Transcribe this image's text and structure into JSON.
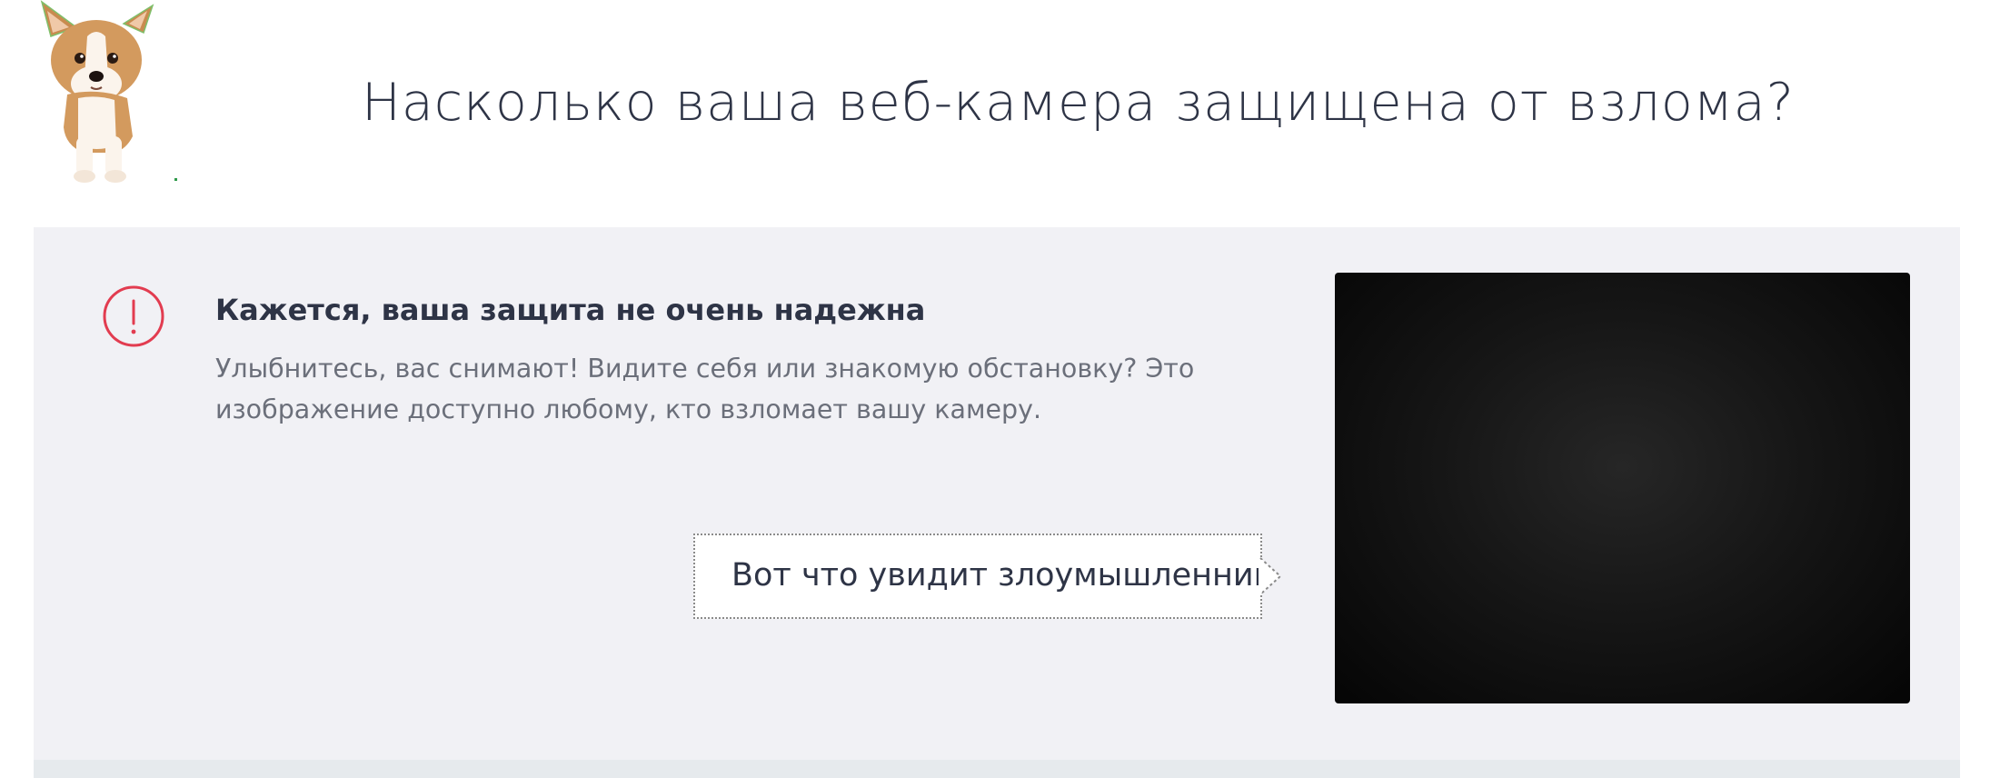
{
  "header": {
    "title": "Насколько ваша веб-камера защищена от взлома?",
    "mascot_icon": "corgi-puppy-mascot"
  },
  "alert": {
    "icon": "exclamation-circle-icon",
    "icon_color": "#e23c50",
    "title": "Кажется, ваша защита не очень надежна",
    "text": "Улыбнитесь, вас снимают! Видите себя или знакомую обстановку? Это изображение доступно любому, кто взломает вашу камеру."
  },
  "callout": {
    "label": "Вот что увидит злоумышленник"
  },
  "camera": {
    "background_color": "#000000"
  },
  "colors": {
    "panel_bg": "#f1f1f5",
    "text_dark": "#2e3446",
    "text_muted": "#6b6f7a"
  }
}
